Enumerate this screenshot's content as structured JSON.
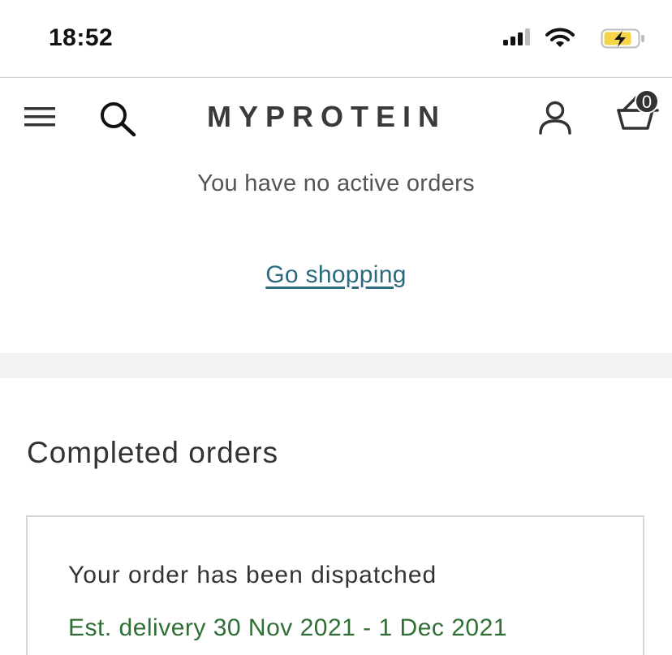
{
  "status_bar": {
    "time": "18:52",
    "icons": [
      "signal-icon",
      "wifi-icon",
      "battery-charging-icon"
    ]
  },
  "header": {
    "logo_text": "MYPROTEIN",
    "icons": [
      "menu-icon",
      "search-icon",
      "account-icon",
      "basket-icon"
    ],
    "basket_count": "0"
  },
  "active_orders": {
    "empty_message": "You have no active orders",
    "go_shopping_link": "Go shopping"
  },
  "completed_orders": {
    "title": "Completed orders",
    "orders": [
      {
        "status": "Your order has been dispatched",
        "delivery": "Est. delivery 30 Nov 2021 - 1 Dec 2021"
      }
    ]
  },
  "colors": {
    "link": "#2b6a7f",
    "delivery_text": "#2f6f35",
    "section_band": "#f2f2f2",
    "battery_fill": "#f5d547"
  }
}
